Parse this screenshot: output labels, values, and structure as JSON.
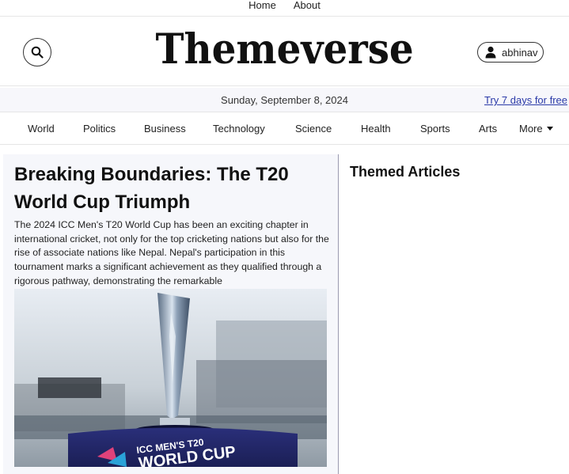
{
  "top_nav": [
    "Home",
    "About"
  ],
  "header": {
    "logo": "Themeverse",
    "user_name": "abhinav",
    "icons": {
      "search": "search-icon",
      "user": "user-icon"
    }
  },
  "datebar": {
    "date": "Sunday, September 8, 2024",
    "trial": "Try 7 days for free"
  },
  "categories": [
    "World",
    "Politics",
    "Business",
    "Technology",
    "Science",
    "Health",
    "Sports",
    "Arts",
    "More"
  ],
  "article": {
    "headline": "Breaking Boundaries: The T20 World Cup Triumph",
    "excerpt": "The 2024 ICC Men's T20 World Cup has been an exciting chapter in international cricket, not only for the top cricketing nations but also for the rise of associate nations like Nepal. Nepal's participation in this tournament marks a significant achievement as they qualified through a rigorous pathway, demonstrating the remarkable",
    "image_text": [
      "ICC MEN'S T20",
      "WORLD CUP"
    ]
  },
  "sidebar": {
    "title": "Themed Articles"
  },
  "colors": {
    "accent_link": "#2b3aa8",
    "panel_bg": "#f6f7fb"
  }
}
